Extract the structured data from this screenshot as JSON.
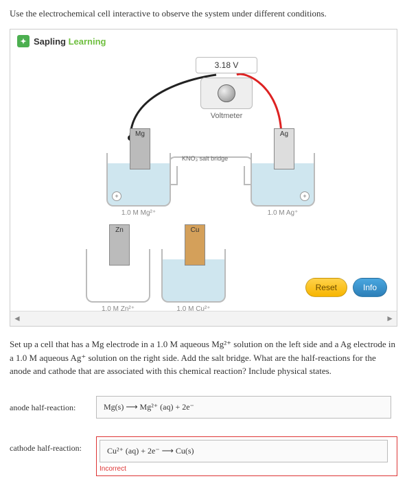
{
  "instruction": "Use the electrochemical cell interactive to observe the system under different conditions.",
  "brand": {
    "sapling": "Sapling",
    "learning": "Learning"
  },
  "voltmeter": {
    "reading": "3.18 V",
    "label": "Voltmeter"
  },
  "salt_bridge": {
    "label": "KNO₃ salt bridge"
  },
  "beakers": {
    "mg": {
      "electrode": "Mg",
      "caption": "1.0 M Mg²⁺"
    },
    "ag": {
      "electrode": "Ag",
      "caption": "1.0 M Ag⁺"
    },
    "zn": {
      "electrode": "Zn",
      "caption": "1.0 M Zn²⁺"
    },
    "cu": {
      "electrode": "Cu",
      "caption": "1.0 M Cu²⁺"
    }
  },
  "buttons": {
    "reset": "Reset",
    "info": "Info"
  },
  "question": "Set up a cell that has a Mg electrode in a 1.0 M aqueous Mg²⁺ solution on the left side and a Ag electrode in a 1.0 M aqueous Ag⁺ solution on the right side. Add the salt bridge. What are the half-reactions for the anode and cathode that are associated with this chemical reaction? Include physical states.",
  "anode": {
    "label": "anode half-reaction:",
    "value": "Mg(s) ⟶ Mg²⁺ (aq) + 2e⁻"
  },
  "cathode": {
    "label": "cathode half-reaction:",
    "value": "Cu²⁺ (aq) + 2e⁻ ⟶ Cu(s)",
    "feedback": "Incorrect"
  },
  "chart_data": {
    "type": "diagram",
    "description": "Electrochemical (galvanic) cell interactive",
    "assembled_cell": {
      "anode_side": {
        "electrode": "Mg",
        "solution": "1.0 M Mg2+",
        "position": "left"
      },
      "cathode_side": {
        "electrode": "Ag",
        "solution": "1.0 M Ag+",
        "position": "right"
      },
      "salt_bridge": "KNO3",
      "measured_voltage_V": 3.18
    },
    "spare_electrodes": [
      {
        "electrode": "Zn",
        "solution": "1.0 M Zn2+"
      },
      {
        "electrode": "Cu",
        "solution": "1.0 M Cu2+"
      }
    ]
  }
}
